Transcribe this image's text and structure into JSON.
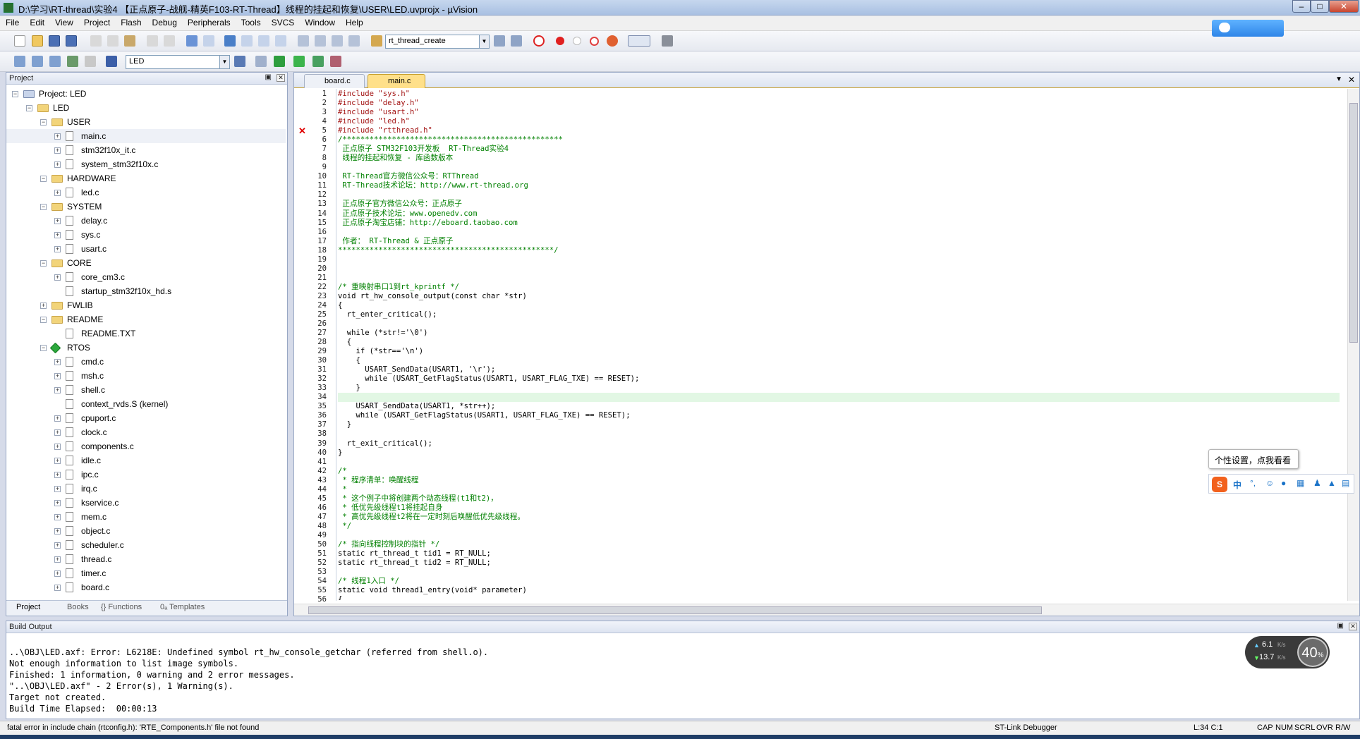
{
  "title": "D:\\学习\\RT-thread\\实验4 【正点原子-战舰-精英F103-RT-Thread】线程的挂起和恢复\\USER\\LED.uvprojx - µVision",
  "menu": [
    "File",
    "Edit",
    "View",
    "Project",
    "Flash",
    "Debug",
    "Peripherals",
    "Tools",
    "SVCS",
    "Window",
    "Help"
  ],
  "toolbar": {
    "function_combo": "rt_thread_create",
    "target_combo": "LED"
  },
  "project_panel": {
    "title": "Project",
    "tree": [
      {
        "label": "Project: LED",
        "depth": 0,
        "kind": "root",
        "expander": "−"
      },
      {
        "label": "LED",
        "depth": 1,
        "kind": "folder",
        "expander": "−"
      },
      {
        "label": "USER",
        "depth": 2,
        "kind": "folder",
        "expander": "−"
      },
      {
        "label": "main.c",
        "depth": 3,
        "kind": "file",
        "expander": "+"
      },
      {
        "label": "stm32f10x_it.c",
        "depth": 3,
        "kind": "file",
        "expander": "+"
      },
      {
        "label": "system_stm32f10x.c",
        "depth": 3,
        "kind": "file",
        "expander": "+"
      },
      {
        "label": "HARDWARE",
        "depth": 2,
        "kind": "folder",
        "expander": "−"
      },
      {
        "label": "led.c",
        "depth": 3,
        "kind": "file",
        "expander": "+"
      },
      {
        "label": "SYSTEM",
        "depth": 2,
        "kind": "folder",
        "expander": "−"
      },
      {
        "label": "delay.c",
        "depth": 3,
        "kind": "file",
        "expander": "+"
      },
      {
        "label": "sys.c",
        "depth": 3,
        "kind": "file",
        "expander": "+"
      },
      {
        "label": "usart.c",
        "depth": 3,
        "kind": "file",
        "expander": "+"
      },
      {
        "label": "CORE",
        "depth": 2,
        "kind": "folder",
        "expander": "−"
      },
      {
        "label": "core_cm3.c",
        "depth": 3,
        "kind": "file",
        "expander": "+"
      },
      {
        "label": "startup_stm32f10x_hd.s",
        "depth": 3,
        "kind": "file",
        "expander": ""
      },
      {
        "label": "FWLIB",
        "depth": 2,
        "kind": "folder",
        "expander": "+"
      },
      {
        "label": "README",
        "depth": 2,
        "kind": "folder",
        "expander": "−"
      },
      {
        "label": "README.TXT",
        "depth": 3,
        "kind": "file",
        "expander": ""
      },
      {
        "label": "RTOS",
        "depth": 2,
        "kind": "rtos",
        "expander": "−"
      },
      {
        "label": "cmd.c",
        "depth": 3,
        "kind": "file",
        "expander": "+"
      },
      {
        "label": "msh.c",
        "depth": 3,
        "kind": "file",
        "expander": "+"
      },
      {
        "label": "shell.c",
        "depth": 3,
        "kind": "file",
        "expander": "+"
      },
      {
        "label": "context_rvds.S (kernel)",
        "depth": 3,
        "kind": "file",
        "expander": ""
      },
      {
        "label": "cpuport.c",
        "depth": 3,
        "kind": "file",
        "expander": "+"
      },
      {
        "label": "clock.c",
        "depth": 3,
        "kind": "file",
        "expander": "+"
      },
      {
        "label": "components.c",
        "depth": 3,
        "kind": "file",
        "expander": "+"
      },
      {
        "label": "idle.c",
        "depth": 3,
        "kind": "file",
        "expander": "+"
      },
      {
        "label": "ipc.c",
        "depth": 3,
        "kind": "file",
        "expander": "+"
      },
      {
        "label": "irq.c",
        "depth": 3,
        "kind": "file",
        "expander": "+"
      },
      {
        "label": "kservice.c",
        "depth": 3,
        "kind": "file",
        "expander": "+"
      },
      {
        "label": "mem.c",
        "depth": 3,
        "kind": "file",
        "expander": "+"
      },
      {
        "label": "object.c",
        "depth": 3,
        "kind": "file",
        "expander": "+"
      },
      {
        "label": "scheduler.c",
        "depth": 3,
        "kind": "file",
        "expander": "+"
      },
      {
        "label": "thread.c",
        "depth": 3,
        "kind": "file",
        "expander": "+"
      },
      {
        "label": "timer.c",
        "depth": 3,
        "kind": "file",
        "expander": "+"
      },
      {
        "label": "board.c",
        "depth": 3,
        "kind": "file",
        "expander": "+"
      }
    ],
    "tabs": [
      "Project",
      "Books",
      "{} Functions",
      "0ₐ Templates"
    ]
  },
  "editor": {
    "tabs": [
      "board.c",
      "main.c"
    ],
    "active_tab": 1,
    "highlight_line": 34,
    "error_line": 5,
    "lines": [
      "#include \"sys.h\"",
      "#include \"delay.h\"",
      "#include \"usart.h\"",
      "#include \"led.h\"",
      "#include \"rtthread.h\"",
      "/*************************************************",
      " 正点原子 STM32F103开发板  RT-Thread实验4",
      " 线程的挂起和恢复 - 库函数版本",
      "",
      " RT-Thread官方微信公众号：RTThread",
      " RT-Thread技术论坛：http://www.rt-thread.org",
      "",
      " 正点原子官方微信公众号：正点原子",
      " 正点原子技术论坛：www.openedv.com",
      " 正点原子淘宝店铺：http://eboard.taobao.com",
      "",
      " 作者： RT-Thread & 正点原子",
      "************************************************/",
      "",
      "",
      "",
      "/* 重映射串口1到rt_kprintf */",
      "void rt_hw_console_output(const char *str)",
      "{",
      "  rt_enter_critical();",
      "",
      "  while (*str!='\\0')",
      "  {",
      "    if (*str=='\\n')",
      "    {",
      "      USART_SendData(USART1, '\\r');",
      "      while (USART_GetFlagStatus(USART1, USART_FLAG_TXE) == RESET);",
      "    }",
      "",
      "    USART_SendData(USART1, *str++);",
      "    while (USART_GetFlagStatus(USART1, USART_FLAG_TXE) == RESET);",
      "  }",
      "",
      "  rt_exit_critical();",
      "}",
      "",
      "/*",
      " * 程序清单：唤醒线程",
      " *",
      " * 这个例子中将创建两个动态线程(t1和t2)，",
      " * 低优先级线程t1将挂起自身",
      " * 高优先级线程t2将在一定时刻后唤醒低优先级线程。",
      " */",
      "",
      "/* 指向线程控制块的指针 */",
      "static rt_thread_t tid1 = RT_NULL;",
      "static rt_thread_t tid2 = RT_NULL;",
      "",
      "/* 线程1入口 */",
      "static void thread1_entry(void* parameter)",
      "{"
    ]
  },
  "build_output": {
    "title": "Build Output",
    "lines": [
      "..\\OBJ\\LED.axf: Error: L6218E: Undefined symbol rt_hw_console_getchar (referred from shell.o).",
      "Not enough information to list image symbols.",
      "Finished: 1 information, 0 warning and 2 error messages.",
      "\"..\\OBJ\\LED.axf\" - 2 Error(s), 1 Warning(s).",
      "Target not created.",
      "Build Time Elapsed:  00:00:13"
    ]
  },
  "status": {
    "message": "fatal error in include chain (rtconfig.h): 'RTE_Components.h' file not found",
    "debugger": "ST-Link Debugger",
    "position": "L:34 C:1",
    "caps": "CAP",
    "num": "NUM",
    "scrl": "SCRL",
    "ovr": "OVR",
    "rw": "R/W"
  },
  "overlays": {
    "ime_tooltip": "个性设置，点我看看",
    "net_up": "6.1",
    "net_down": "13.7",
    "net_unit": "K/s",
    "net_percent": "40",
    "ime_mode": "中"
  },
  "colors": {
    "keyword": "#0000ff",
    "comment": "#008000",
    "string": "#a31515",
    "error": "#e00000",
    "highlight": "#e2f7e4"
  }
}
